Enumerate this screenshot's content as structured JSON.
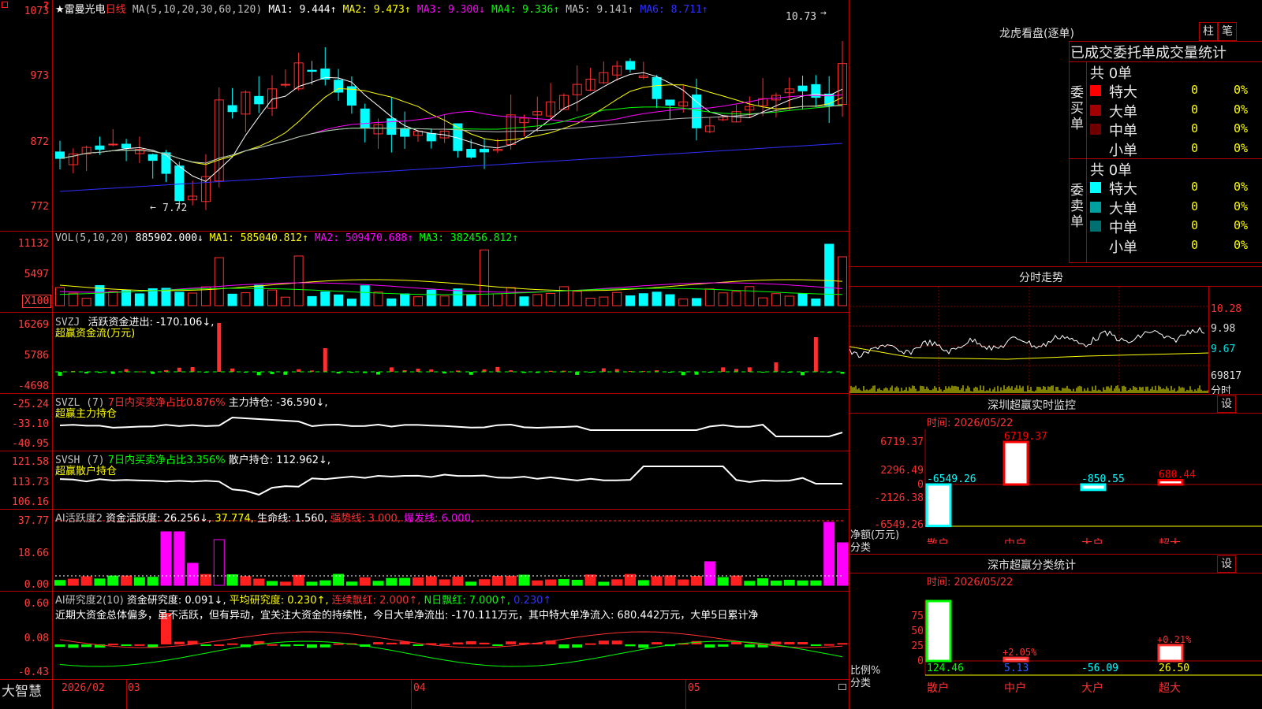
{
  "kline": {
    "star": "★",
    "stock_name": "雷曼光电",
    "period": "日线",
    "ma_header": "MA(5,10,20,30,60,120)",
    "ma": [
      {
        "text": "MA1: 9.444↑",
        "color": "#ffffff"
      },
      {
        "text": "MA2: 9.473↑",
        "color": "#ffff00"
      },
      {
        "text": "MA3: 9.300↓",
        "color": "#ff00ff"
      },
      {
        "text": "MA4: 9.336↑",
        "color": "#00ff00"
      },
      {
        "text": "MA5: 9.141↑",
        "color": "#c0c0c0"
      },
      {
        "text": "MA6: 8.711↑",
        "color": "#3030ff"
      }
    ],
    "y_ticks": [
      "1073",
      "973",
      "872",
      "772"
    ],
    "high_label": "10.73",
    "low_label": "7.72"
  },
  "vol": {
    "header": "VOL(5,10,20)",
    "value": "885902.000↓",
    "ma": [
      {
        "text": "MA1: 585040.812↑",
        "color": "#ffff00"
      },
      {
        "text": "MA2: 509470.688↑",
        "color": "#ff00ff"
      },
      {
        "text": "MA3: 382456.812↑",
        "color": "#00ff00"
      }
    ],
    "y_ticks": [
      "11132",
      "5497"
    ],
    "unit": "X100"
  },
  "svzj": {
    "header": "SVZJ",
    "label": "活跃资金进出: -170.106↓,",
    "subtitle": "超赢资金流(万元)",
    "y_ticks": [
      "16269",
      "5786",
      "-4698"
    ]
  },
  "svzl": {
    "header": "SVZL (7)",
    "pct": "7日内买卖净占比0.876%",
    "label": "主力持仓: -36.590↓,",
    "subtitle": "超赢主力持仓",
    "y_ticks": [
      "-25.24",
      "-33.10",
      "-40.95"
    ]
  },
  "svsh": {
    "header": "SVSH (7)",
    "pct": "7日内买卖净占比3.356%",
    "label": "散户持仓: 112.962↓,",
    "subtitle": "超赢散户持仓",
    "y_ticks": [
      "121.58",
      "113.73",
      "106.16"
    ]
  },
  "ai1": {
    "header": "AI活跃度2",
    "label1": "资金活跃度: 26.256↓,",
    "label2": "37.774,",
    "label3": "生命线: 1.560,",
    "label4": "强势线: 3.000,",
    "label5": "爆发线: 6.000,",
    "y_ticks": [
      "37.77",
      "18.66",
      "0.00"
    ]
  },
  "ai2": {
    "header": "AI研究度2(10)",
    "label1": "资金研究度: 0.091↓,",
    "label2": "平均研究度: 0.230↑,",
    "label3": "连续飘红: 2.000↑,",
    "label4": "N日飘红: 7.000↑,",
    "label5": "0.230↑",
    "comment": "近期大资金总体偏多，虽不活跃，但有异动，宜关注大资金的持续性，今日大单净流出: -170.111万元，其中特大单净流入: 680.442万元，大单5日累计净",
    "y_ticks": [
      "0.60",
      "0.08",
      "-0.43"
    ]
  },
  "footer": {
    "brand": "大智慧",
    "dates": [
      "2026/02",
      "03",
      "04",
      "05"
    ]
  },
  "right": {
    "lhkp": {
      "title": "龙虎看盘(逐单)",
      "btn_col": "柱",
      "btn_pen": "笔",
      "header": "已成交委托单成交量统计",
      "buy_label": "委买单",
      "sell_label": "委卖单",
      "buy_total": "共 0单",
      "sell_total": "共 0单",
      "buy_rows": [
        {
          "name": "特大",
          "count": "0",
          "pct": "0%",
          "color": "#ff0000"
        },
        {
          "name": "大单",
          "count": "0",
          "pct": "0%",
          "color": "#a00000"
        },
        {
          "name": "中单",
          "count": "0",
          "pct": "0%",
          "color": "#700000"
        },
        {
          "name": "小单",
          "count": "0",
          "pct": "0%",
          "color": ""
        }
      ],
      "sell_rows": [
        {
          "name": "特大",
          "count": "0",
          "pct": "0%",
          "color": "#00ffff"
        },
        {
          "name": "大单",
          "count": "0",
          "pct": "0%",
          "color": "#00a0a0"
        },
        {
          "name": "中单",
          "count": "0",
          "pct": "0%",
          "color": "#007070"
        },
        {
          "name": "小单",
          "count": "0",
          "pct": "0%",
          "color": ""
        }
      ]
    },
    "fenshi": {
      "title": "分时走势",
      "prices": [
        "10.28",
        "9.98",
        "9.67"
      ],
      "vol": "69817",
      "vol_label": "分时"
    },
    "sz_monitor": {
      "title": "深圳超赢实时监控",
      "btn": "设",
      "time": "时间: 2026/05/22",
      "y_ticks": [
        "6719.37",
        "2296.49",
        "0",
        "-2126.38",
        "-6549.26"
      ],
      "bars": [
        {
          "label": "-6549.26",
          "value": -6549.26,
          "cat": "散户",
          "color": "#00ffff"
        },
        {
          "label": "6719.37",
          "value": 6719.37,
          "cat": "中户",
          "color": "#ff0000"
        },
        {
          "label": "-850.55",
          "value": -850.55,
          "cat": "大户",
          "color": "#00ffff"
        },
        {
          "label": "680.44",
          "value": 680.44,
          "cat": "超大",
          "color": "#ff0000"
        }
      ],
      "footer1": "净额(万元)",
      "footer2": "分类"
    },
    "sz_class": {
      "title": "深市超赢分类统计",
      "btn": "设",
      "time": "时间: 2026/05/22",
      "y_ticks": [
        "75",
        "50",
        "25",
        "0"
      ],
      "bars": [
        {
          "label": "124.46",
          "top": "",
          "value": 124.46,
          "cat": "散户"
        },
        {
          "label": "5.13",
          "top": "+2.05%",
          "value": 5.13,
          "cat": "中户"
        },
        {
          "label": "-56.09",
          "top": "",
          "value": -56.09,
          "cat": "大户"
        },
        {
          "label": "26.50",
          "top": "+0.21%",
          "value": 26.5,
          "cat": "超大"
        }
      ],
      "footer1": "比例%",
      "footer2": "分类"
    }
  }
}
